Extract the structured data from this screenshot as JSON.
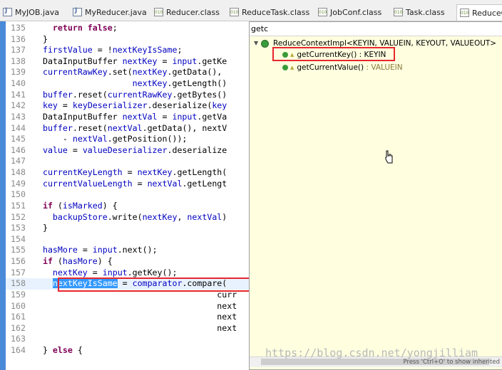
{
  "tabs": [
    {
      "label": "MyJOB.java",
      "kind": "java"
    },
    {
      "label": "MyReducer.java",
      "kind": "java"
    },
    {
      "label": "Reducer.class",
      "kind": "class"
    },
    {
      "label": "ReduceTask.class",
      "kind": "class"
    },
    {
      "label": "JobConf.class",
      "kind": "class"
    },
    {
      "label": "Task.class",
      "kind": "class"
    },
    {
      "label": "ReduceCo",
      "kind": "class"
    }
  ],
  "editor": {
    "lines": [
      {
        "n": "135",
        "text": "    return false;"
      },
      {
        "n": "136",
        "text": "  }"
      },
      {
        "n": "137",
        "text": "  firstValue = !nextKeyIsSame;"
      },
      {
        "n": "138",
        "text": "  DataInputBuffer nextKey = input.getKe"
      },
      {
        "n": "139",
        "text": "  currentRawKey.set(nextKey.getData(),"
      },
      {
        "n": "140",
        "text": "                    nextKey.getLength()"
      },
      {
        "n": "141",
        "text": "  buffer.reset(currentRawKey.getBytes()"
      },
      {
        "n": "142",
        "text": "  key = keyDeserializer.deserialize(key"
      },
      {
        "n": "143",
        "text": "  DataInputBuffer nextVal = input.getVa"
      },
      {
        "n": "144",
        "text": "  buffer.reset(nextVal.getData(), nextV"
      },
      {
        "n": "145",
        "text": "      - nextVal.getPosition());"
      },
      {
        "n": "146",
        "text": "  value = valueDeserializer.deserialize"
      },
      {
        "n": "147",
        "text": ""
      },
      {
        "n": "148",
        "text": "  currentKeyLength = nextKey.getLength("
      },
      {
        "n": "149",
        "text": "  currentValueLength = nextVal.getLengt"
      },
      {
        "n": "150",
        "text": ""
      },
      {
        "n": "151",
        "text": "  if (isMarked) {"
      },
      {
        "n": "152",
        "text": "    backupStore.write(nextKey, nextVal)"
      },
      {
        "n": "153",
        "text": "  }"
      },
      {
        "n": "154",
        "text": ""
      },
      {
        "n": "155",
        "text": "  hasMore = input.next();"
      },
      {
        "n": "156",
        "text": "  if (hasMore) {"
      },
      {
        "n": "157",
        "text": "    nextKey = input.getKey();"
      },
      {
        "n": "158",
        "text": "    nextKeyIsSame = comparator.compare("
      },
      {
        "n": "159",
        "text": "                                     curr"
      },
      {
        "n": "160",
        "text": "                                     next"
      },
      {
        "n": "161",
        "text": "                                     next"
      },
      {
        "n": "162",
        "text": "                                     next"
      },
      {
        "n": "163",
        "text": ""
      },
      {
        "n": "164",
        "text": "  } else {"
      }
    ],
    "selected_text": "nextKeyIsSame"
  },
  "popup": {
    "filter_value": "getc",
    "class_entry": "ReduceContextImpl<KEYIN, VALUEIN, KEYOUT, VALUEOUT>",
    "methods": [
      {
        "name": "getCurrentKey()",
        "sep": " : ",
        "type": "KEYIN"
      },
      {
        "name": "getCurrentValue()",
        "sep": " : ",
        "type": "VALUEIN"
      }
    ],
    "status": "Press 'Ctrl+O' to show inherited"
  },
  "watermark": "https://blog.csdn.net/yongjilliam"
}
